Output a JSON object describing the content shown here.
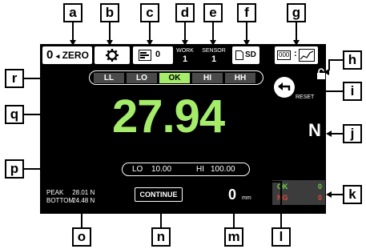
{
  "callouts": {
    "a": "a",
    "b": "b",
    "c": "c",
    "d": "d",
    "e": "e",
    "f": "f",
    "g": "g",
    "h": "h",
    "i": "i",
    "j": "j",
    "k": "k",
    "l": "l",
    "m": "m",
    "n": "n",
    "o": "o",
    "p": "p",
    "q": "q",
    "r": "r"
  },
  "top_bar": {
    "zero_value": "0",
    "zero_label": "ZERO",
    "memory_value": "0",
    "work_label": "WORK",
    "work_value": "1",
    "sensor_label": "SENSOR",
    "sensor_value": "1",
    "sd_label": "SD",
    "counter_box": "000"
  },
  "judgement": [
    "LL",
    "LO",
    "OK",
    "HI",
    "HH"
  ],
  "judgement_active": "OK",
  "reset_label": "RESET",
  "measurement": {
    "value": "27.94",
    "unit": "N"
  },
  "limits": {
    "lo_label": "LO",
    "lo_value": "10.00",
    "hi_label": "HI",
    "hi_value": "100.00"
  },
  "peak": {
    "peak_label": "PEAK",
    "peak_value": "28.01 N",
    "bottom_label": "BOTTOM",
    "bottom_value": "24.48 N"
  },
  "continue_label": "CONTINUE",
  "displacement": {
    "value": "0",
    "unit": "mm"
  },
  "counts": {
    "ok_label": "OK",
    "ok_value": "0",
    "ng_label": "NG",
    "ng_value": "0"
  },
  "colors": {
    "accent_green": "#a5ec6a",
    "ng_red": "#e04a3a",
    "ok_green": "#6fd14a",
    "screen_bg": "#000000"
  }
}
